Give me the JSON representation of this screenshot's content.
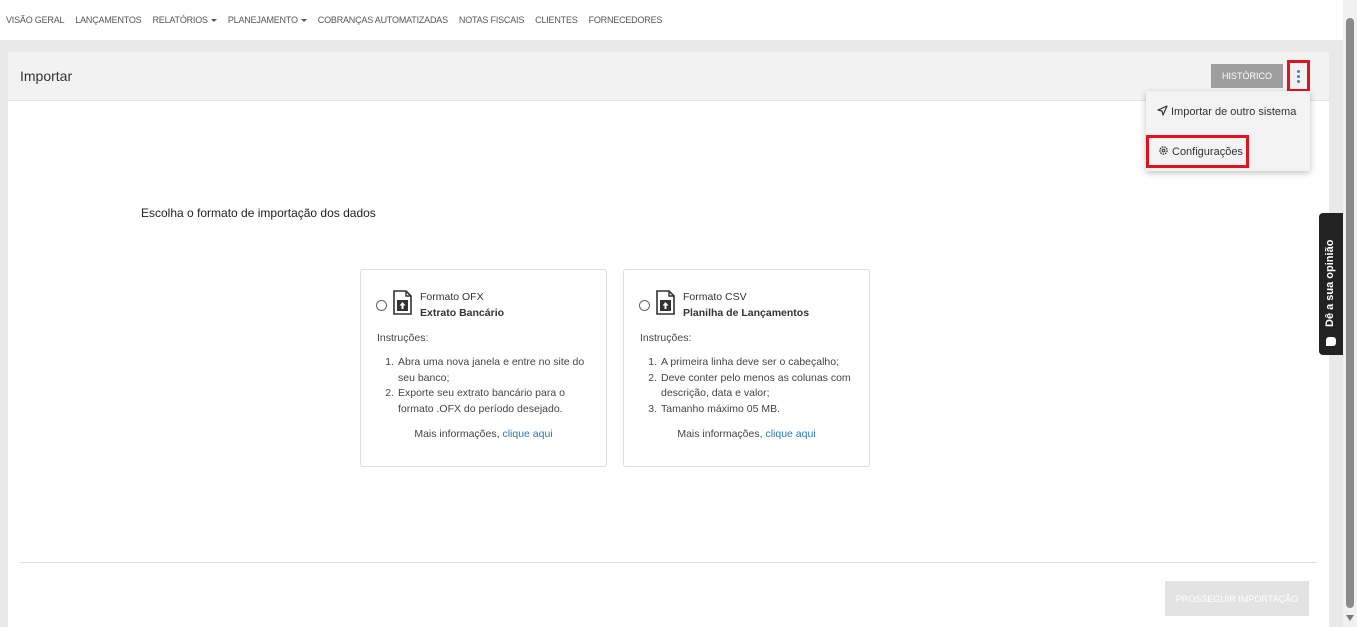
{
  "nav": {
    "items": [
      {
        "label": "VISÃO GERAL",
        "caret": false
      },
      {
        "label": "LANÇAMENTOS",
        "caret": false
      },
      {
        "label": "RELATÓRIOS",
        "caret": true
      },
      {
        "label": "PLANEJAMENTO",
        "caret": true
      },
      {
        "label": "COBRANÇAS AUTOMATIZADAS",
        "caret": false
      },
      {
        "label": "NOTAS FISCAIS",
        "caret": false
      },
      {
        "label": "CLIENTES",
        "caret": false
      },
      {
        "label": "FORNECEDORES",
        "caret": false
      }
    ]
  },
  "header": {
    "title": "Importar",
    "historico_label": "HISTÓRICO"
  },
  "menu": {
    "import_other": "Importar de outro sistema",
    "settings": "Configurações"
  },
  "main": {
    "section_title": "Escolha o formato de importação dos dados",
    "cards": [
      {
        "format": "Formato OFX",
        "subtitle": "Extrato Bancário",
        "instructions_label": "Instruções:",
        "steps": [
          "Abra uma nova janela e entre no site do seu banco;",
          "Exporte seu extrato bancário para o formato .OFX do período desejado."
        ],
        "more_text": "Mais informações,",
        "more_link": "clique aqui"
      },
      {
        "format": "Formato CSV",
        "subtitle": "Planilha de Lançamentos",
        "instructions_label": "Instruções:",
        "steps": [
          "A primeira linha deve ser o cabeçalho;",
          "Deve conter pelo menos as colunas com descrição, data e valor;",
          "Tamanho máximo 05 MB."
        ],
        "more_text": "Mais informações,",
        "more_link": "clique aqui"
      }
    ],
    "proceed_label": "PROSSEGUIR IMPORTAÇÃO"
  },
  "feedback": {
    "label": "Dê a sua opinião"
  }
}
